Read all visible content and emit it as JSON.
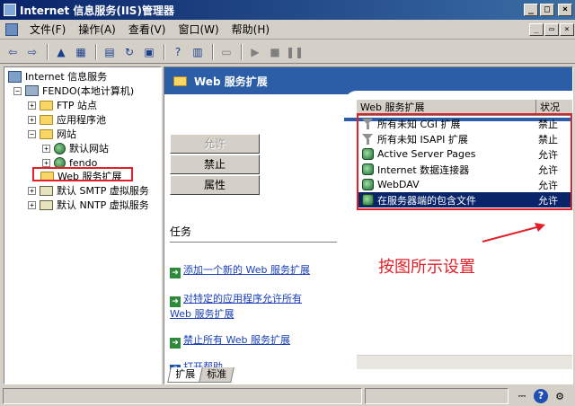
{
  "window": {
    "title": "Internet 信息服务(IIS)管理器",
    "controls": {
      "minimize": "_",
      "maximize": "□",
      "close": "×"
    }
  },
  "menu": {
    "items": [
      "文件(F)",
      "操作(A)",
      "查看(V)",
      "窗口(W)",
      "帮助(H)"
    ],
    "mdi": {
      "minimize": "_",
      "restore": "▭",
      "close": "×"
    }
  },
  "toolbar": {
    "icons": [
      "back-arrow-icon",
      "forward-arrow-icon",
      "up-folder-icon",
      "show-tree-icon",
      "properties-icon",
      "refresh-icon",
      "export-icon",
      "help-icon",
      "details-icon",
      "computer-icon",
      "play-icon",
      "stop-icon",
      "pause-icon"
    ]
  },
  "tree": {
    "root": "Internet 信息服务",
    "server": "FENDO(本地计算机)",
    "ftp": "FTP 站点",
    "app_pools": "应用程序池",
    "websites": "网站",
    "default_site": "默认网站",
    "fendo_site": "fendo",
    "web_ext": "Web 服务扩展",
    "smtp": "默认 SMTP 虚拟服务",
    "nntp": "默认 NNTP 虚拟服务"
  },
  "banner": {
    "title": "Web 服务扩展"
  },
  "actions": {
    "allow": "允许",
    "prohibit": "禁止",
    "properties": "属性"
  },
  "tasks": {
    "title": "任务",
    "add_new": "添加一个新的 Web 服务扩展",
    "allow_app_1": "对特定的应用程序允许所有",
    "allow_app_2": "Web 服务扩展",
    "prohibit_all": "禁止所有 Web 服务扩展",
    "open_help": "打开帮助"
  },
  "list": {
    "columns": [
      "Web 服务扩展",
      "状况"
    ],
    "rows": [
      {
        "name": "所有未知 CGI 扩展",
        "status": "禁止",
        "icon": "filter-icon"
      },
      {
        "name": "所有未知 ISAPI 扩展",
        "status": "禁止",
        "icon": "filter-icon"
      },
      {
        "name": "Active Server Pages",
        "status": "允许",
        "icon": "extension-icon"
      },
      {
        "name": "Internet 数据连接器",
        "status": "允许",
        "icon": "extension-icon"
      },
      {
        "name": "WebDAV",
        "status": "允许",
        "icon": "extension-icon"
      },
      {
        "name": "在服务器端的包含文件",
        "status": "允许",
        "icon": "extension-icon",
        "selected": true
      }
    ]
  },
  "annotation": {
    "text": "按图所示设置",
    "color": "#e0202a"
  },
  "tabs": {
    "extended": "扩展",
    "standard": "标准"
  },
  "colors": {
    "banner": "#2b5ea7",
    "highlight": "#e0202a",
    "selection": "#0a246a"
  }
}
